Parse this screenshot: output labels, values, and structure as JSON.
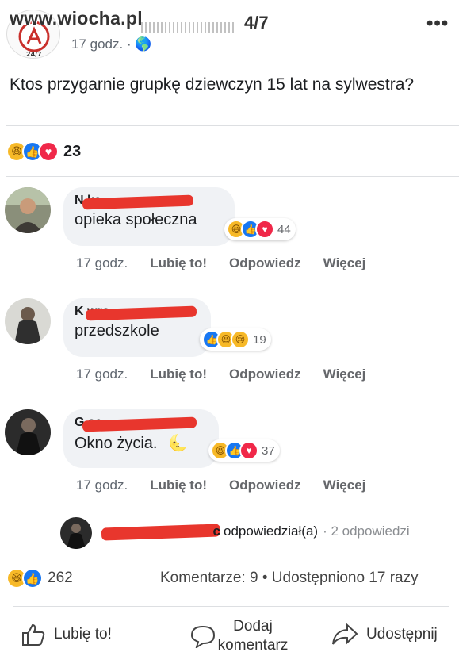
{
  "watermark": "www.wiocha.pl",
  "post": {
    "page_name": "4/7",
    "time": "17 godz. · 🌎",
    "text": "Ktos przygarnie grupkę dziewczyn 15 lat na sylwestra?",
    "reaction_count": "23",
    "reactions": [
      "haha",
      "like",
      "love"
    ]
  },
  "comments": [
    {
      "name_visible": "N            ka",
      "text": "opieka społeczna",
      "reactions": [
        "haha",
        "like",
        "love"
      ],
      "reaction_count": "44",
      "time": "17 godz.",
      "like_label": "Lubię to!",
      "reply_label": "Odpowiedz",
      "more_label": "Więcej"
    },
    {
      "name_visible": "K            wro",
      "text": "przedszkole",
      "reactions": [
        "like",
        "haha",
        "sad"
      ],
      "reaction_count": "19",
      "time": "17 godz.",
      "like_label": "Lubię to!",
      "reply_label": "Odpowiedz",
      "more_label": "Więcej"
    },
    {
      "name_visible": "G            ec",
      "text": "Okno życia.",
      "reactions": [
        "haha",
        "like",
        "love"
      ],
      "reaction_count": "37",
      "time": "17 godz.",
      "like_label": "Lubię to!",
      "reply_label": "Odpowiedz",
      "more_label": "Więcej"
    }
  ],
  "reply": {
    "name_suffix": "c",
    "verb": "odpowiedział(a)",
    "count": "· 2 odpowiedzi"
  },
  "stats": {
    "reactions": "262",
    "summary": "Komentarze: 9 • Udostępniono 17 razy"
  },
  "actions": {
    "like": "Lubię to!",
    "comment": "Dodaj komentarz",
    "share": "Udostępnij"
  },
  "colors": {
    "like": "#1877f2",
    "love": "#f02849",
    "haha": "#f7b928",
    "redaction": "#e8362d"
  }
}
